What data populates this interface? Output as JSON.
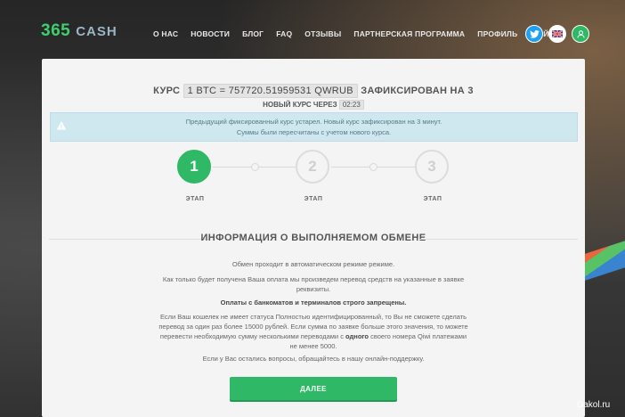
{
  "header": {
    "logo_number": "365",
    "logo_text": "CASH",
    "nav": [
      "О НАС",
      "НОВОСТИ",
      "БЛОГ",
      "FAQ",
      "ОТЗЫВЫ",
      "ПАРТНЕРСКАЯ ПРОГРАММА",
      "ПРОФИЛЬ",
      "ВЫЙТИ"
    ],
    "icons": [
      "twitter-icon",
      "uk-flag-icon",
      "user-icon"
    ]
  },
  "rate": {
    "prefix": "КУРС",
    "value": "1 BTC = 757720.51959531 QWRUB",
    "suffix": "ЗАФИКСИРОВАН НА 3",
    "next_prefix": "НОВЫЙ КУРС ЧЕРЕЗ",
    "timer": "02:23"
  },
  "alert": {
    "line1": "Предыдущий фиксированный курс устарел. Новый курс зафиксирован на 3 минут.",
    "line2": "Суммы были пересчитаны с учетом нового курса."
  },
  "steps": [
    {
      "number": "1",
      "label": "ЭТАП",
      "active": true
    },
    {
      "number": "2",
      "label": "ЭТАП",
      "active": false
    },
    {
      "number": "3",
      "label": "ЭТАП",
      "active": false
    }
  ],
  "info": {
    "title": "ИНФОРМАЦИЯ О ВЫПОЛНЯЕМОМ ОБМЕНЕ",
    "p1": "Обмен проходит в автоматическом режиме режиме.",
    "p2_line1": "Как только будет получена Ваша оплата мы произведем перевод средств на указанные в заявке",
    "p2_line2": "реквизиты.",
    "warning": "Оплаты с банкоматов и терминалов строго запрещены.",
    "p3_line1": "Если Ваш кошелек не имеет статуса Полностью идентифицированный, то Вы не сможете сделать",
    "p3_line2": "перевод за один раз более 15000 рублей. Если сумма по заявке больше этого значения, то можете",
    "p3_line3_a": "перевести необходимую сумму несколькими переводами с",
    "p3_line3_b": "одного",
    "p3_line3_c": "своего номера Qiwi платежами",
    "p3_line4": "не менее 5000.",
    "p4": "Если у Вас остались вопросы, обращайтесь в нашу онлайн-поддержку."
  },
  "button_label": "ДАЛЕЕ",
  "watermark": "Dakol.ru",
  "colors": {
    "accent": "#2fb866",
    "alert_bg": "#cfe8ef",
    "card_bg": "#f4f4f4"
  }
}
